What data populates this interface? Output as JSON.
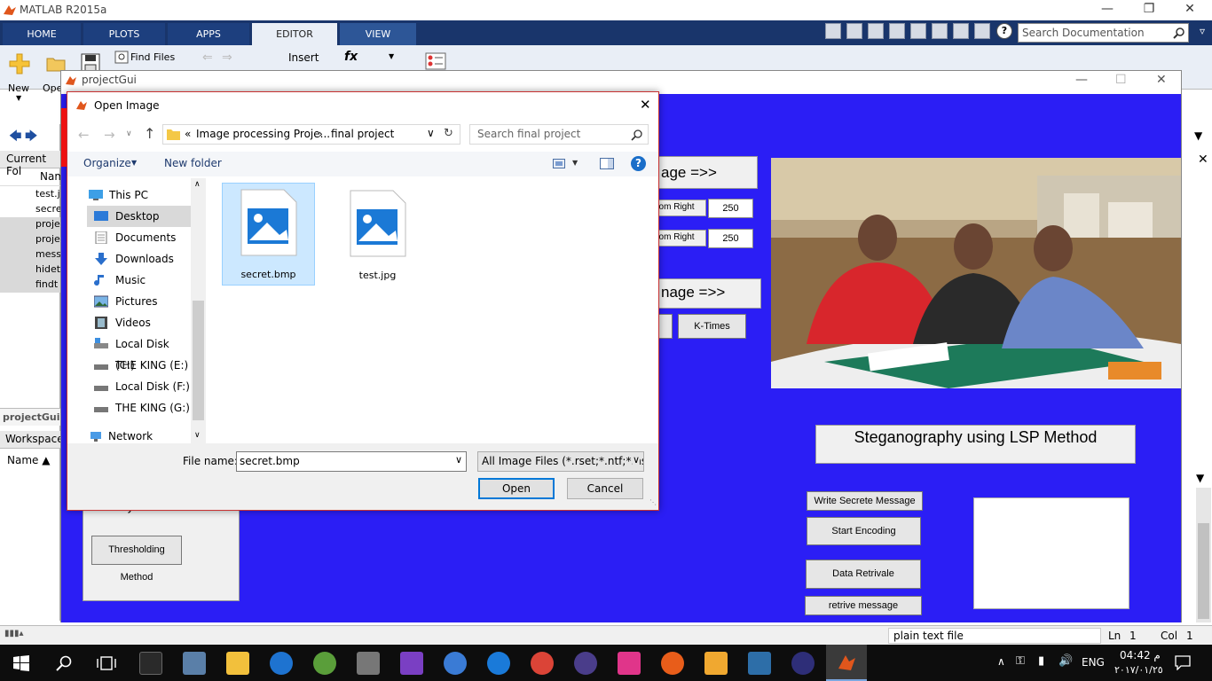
{
  "matlab": {
    "title": "MATLAB R2015a",
    "tabs": [
      "HOME",
      "PLOTS",
      "APPS",
      "EDITOR",
      "VIEW"
    ],
    "search_placeholder": "Search Documentation",
    "ribbon": {
      "new": "New",
      "open": "Ope",
      "find_files": "Find Files",
      "insert": "Insert",
      "fx": "fx"
    },
    "current_folder_label": "Current Fol",
    "files_header": "Nam",
    "files": [
      "test.j",
      "secre",
      "proje",
      "proje",
      "mess",
      "hidet",
      "findt"
    ],
    "details_label": "projectGui.r",
    "workspace_label": "Workspace",
    "workspace_name_col": "Name ▲"
  },
  "status": {
    "file_type": "plain text file",
    "ln_label": "Ln",
    "ln": "1",
    "col_label": "Col",
    "col": "1"
  },
  "gui": {
    "title": "projectGui",
    "image_label_1": "age =>>",
    "image_label_2": "nage =>>",
    "bottom_right_1": "ttom Right",
    "bottom_right_2": "ttom Right",
    "value_1": "250",
    "value_2": "250",
    "k_times": "K-Times",
    "heading": "Steganography using LSP Method",
    "write_secret": "Write Secrete Message",
    "start_encoding": "Start Encoding",
    "data_retrieval": "Data Retrivale",
    "retrieve_message": "retrive message",
    "binary_label": "to Binary Coversion",
    "thresholding": "Thresholding Method"
  },
  "dialog": {
    "title": "Open Image",
    "breadcrumb_prefix": "«",
    "breadcrumb_1": "Image processing Proje...",
    "breadcrumb_sep": "›",
    "breadcrumb_2": "final project",
    "search_placeholder": "Search final project",
    "organize": "Organize",
    "new_folder": "New folder",
    "nav": [
      "This PC",
      "Desktop",
      "Documents",
      "Downloads",
      "Music",
      "Pictures",
      "Videos",
      "Local Disk (C:)",
      "THE KING (E:)",
      "Local Disk (F:)",
      "THE KING  (G:)",
      "Network"
    ],
    "files": [
      "secret.bmp",
      "test.jpg"
    ],
    "filename_label": "File name:",
    "filename_value": "secret.bmp",
    "filter": "All Image Files (*.rset;*.ntf;*.nsf,",
    "open_btn": "Open",
    "cancel_btn": "Cancel"
  },
  "taskbar": {
    "lang": "ENG",
    "time": "04:42 م",
    "date": "٢٠١٧/٠١/٢٥"
  }
}
